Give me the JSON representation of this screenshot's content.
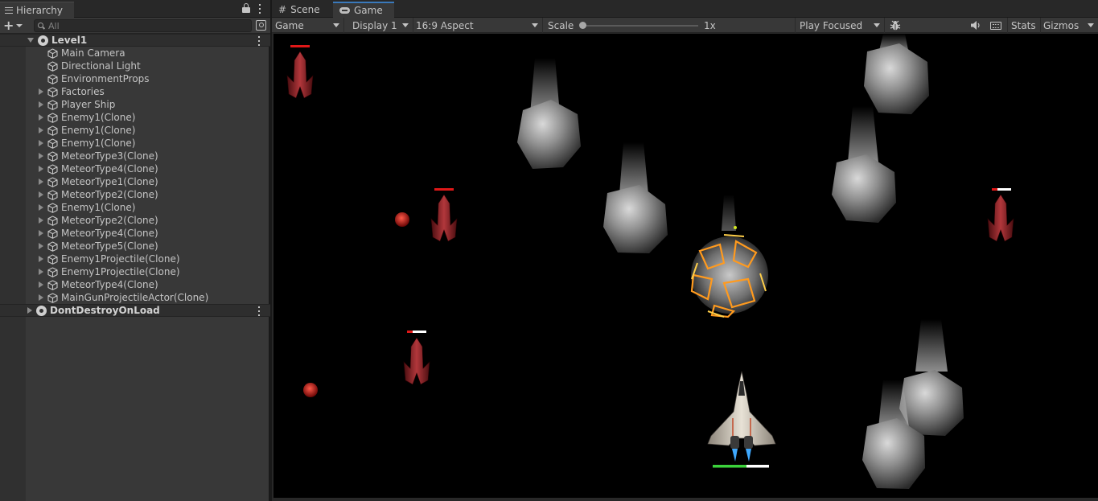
{
  "hierarchy": {
    "tab_label": "Hierarchy",
    "search_placeholder": "All",
    "items": [
      {
        "label": "Level1",
        "type": "scene"
      },
      {
        "label": "Main Camera",
        "type": "object"
      },
      {
        "label": "Directional Light",
        "type": "object"
      },
      {
        "label": "EnvironmentProps",
        "type": "object"
      },
      {
        "label": "Factories",
        "type": "object-collapsed"
      },
      {
        "label": "Player Ship",
        "type": "object-collapsed"
      },
      {
        "label": "Enemy1(Clone)",
        "type": "object-collapsed"
      },
      {
        "label": "Enemy1(Clone)",
        "type": "object-collapsed"
      },
      {
        "label": "Enemy1(Clone)",
        "type": "object-collapsed"
      },
      {
        "label": "MeteorType3(Clone)",
        "type": "object-collapsed"
      },
      {
        "label": "MeteorType4(Clone)",
        "type": "object-collapsed"
      },
      {
        "label": "MeteorType1(Clone)",
        "type": "object-collapsed"
      },
      {
        "label": "MeteorType2(Clone)",
        "type": "object-collapsed"
      },
      {
        "label": "Enemy1(Clone)",
        "type": "object-collapsed"
      },
      {
        "label": "MeteorType2(Clone)",
        "type": "object-collapsed"
      },
      {
        "label": "MeteorType4(Clone)",
        "type": "object-collapsed"
      },
      {
        "label": "MeteorType5(Clone)",
        "type": "object-collapsed"
      },
      {
        "label": "Enemy1Projectile(Clone)",
        "type": "object-collapsed"
      },
      {
        "label": "Enemy1Projectile(Clone)",
        "type": "object-collapsed"
      },
      {
        "label": "MeteorType4(Clone)",
        "type": "object-collapsed"
      },
      {
        "label": "MainGunProjectileActor(Clone)",
        "type": "object-collapsed"
      },
      {
        "label": "DontDestroyOnLoad",
        "type": "scene-collapsed"
      }
    ]
  },
  "game_view": {
    "tabs": {
      "scene": "Scene",
      "game": "Game"
    },
    "toolbar": {
      "view_mode": "Game",
      "display": "Display 1",
      "aspect": "16:9 Aspect",
      "scale_label": "Scale",
      "scale_value": "1x",
      "play_mode": "Play Focused",
      "stats": "Stats",
      "gizmos": "Gizmos"
    },
    "icons": {
      "bug": "bug-icon",
      "speaker": "speaker-icon",
      "keyboard": "keyboard-icon"
    },
    "colors": {
      "health_player": "#3bd23b",
      "health_enemy": "#e01818",
      "enemy_body": "#8e1f23",
      "tab_accent": "#3a79bb"
    },
    "player_health_fraction": 0.6,
    "enemies_health_fraction": [
      1.0,
      1.0,
      0.3,
      0.3
    ]
  }
}
